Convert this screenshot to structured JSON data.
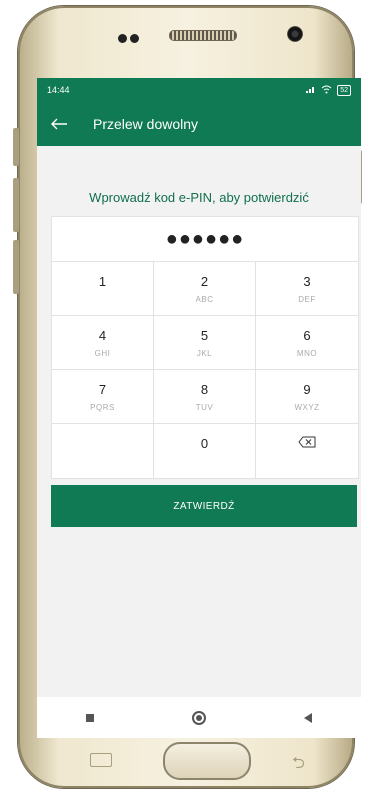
{
  "status_bar": {
    "time": "14:44",
    "signal_icon": "signal-icon",
    "wifi_icon": "wifi-icon",
    "battery": "52"
  },
  "app_bar": {
    "back_icon": "arrow-left-icon",
    "title": "Przelew dowolny"
  },
  "prompt": "Wprowadź kod e-PIN, aby potwierdzić",
  "pin": {
    "masked": "●●●●●●"
  },
  "keypad": [
    {
      "digit": "1",
      "letters": ""
    },
    {
      "digit": "2",
      "letters": "ABC"
    },
    {
      "digit": "3",
      "letters": "DEF"
    },
    {
      "digit": "4",
      "letters": "GHI"
    },
    {
      "digit": "5",
      "letters": "JKL"
    },
    {
      "digit": "6",
      "letters": "MNO"
    },
    {
      "digit": "7",
      "letters": "PQRS"
    },
    {
      "digit": "8",
      "letters": "TUV"
    },
    {
      "digit": "9",
      "letters": "WXYZ"
    },
    {
      "digit": "",
      "letters": ""
    },
    {
      "digit": "0",
      "letters": ""
    },
    {
      "digit": "⌫",
      "letters": ""
    }
  ],
  "confirm_label": "ZATWIERDŹ",
  "colors": {
    "brand_green": "#107a54",
    "prompt_green": "#106f4c"
  }
}
